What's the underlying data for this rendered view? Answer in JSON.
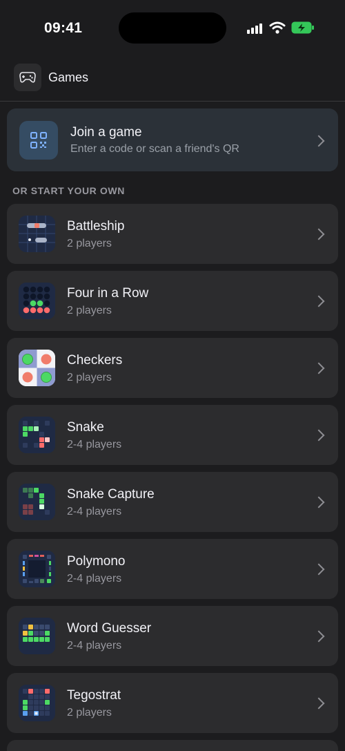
{
  "status_bar": {
    "time": "09:41"
  },
  "header": {
    "title": "Games",
    "icon": "gamepad-icon"
  },
  "join": {
    "title": "Join a game",
    "subtitle": "Enter a code or scan a friend's QR",
    "icon": "qr-code-icon"
  },
  "section_label": "OR START YOUR OWN",
  "games": [
    {
      "title": "Battleship",
      "players": "2 players",
      "icon": "battleship-icon"
    },
    {
      "title": "Four in a Row",
      "players": "2 players",
      "icon": "four-in-a-row-icon"
    },
    {
      "title": "Checkers",
      "players": "2 players",
      "icon": "checkers-icon"
    },
    {
      "title": "Snake",
      "players": "2-4 players",
      "icon": "snake-icon"
    },
    {
      "title": "Snake Capture",
      "players": "2-4 players",
      "icon": "snake-capture-icon"
    },
    {
      "title": "Polymono",
      "players": "2-4 players",
      "icon": "polymono-icon"
    },
    {
      "title": "Word Guesser",
      "players": "2-4 players",
      "icon": "word-guesser-icon"
    },
    {
      "title": "Tegostrat",
      "players": "2 players",
      "icon": "tegostrat-icon"
    }
  ],
  "colors": {
    "background": "#1c1c1e",
    "card": "#2c2c2e",
    "join_card": "#2b3138",
    "accent_blue": "#7fb2ff",
    "green": "#4cd964",
    "red": "#ff6b6b"
  }
}
